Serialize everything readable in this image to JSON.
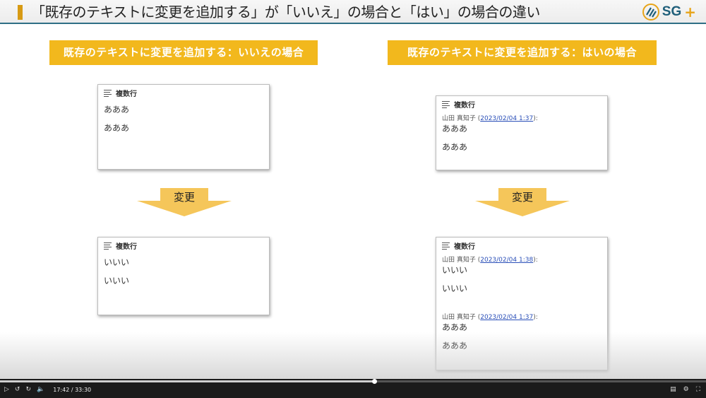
{
  "header": {
    "title": "「既存のテキストに変更を追加する」が「いいえ」の場合と「はい」の場合の違い",
    "logo_text": "SG",
    "logo_plus": "+"
  },
  "left": {
    "heading": "既存のテキストに変更を追加する：いいえの場合",
    "before": {
      "label": "複数行",
      "lines": [
        "あああ",
        "あああ"
      ]
    },
    "arrow_label": "変更",
    "after": {
      "label": "複数行",
      "lines": [
        "いいい",
        "いいい"
      ]
    }
  },
  "right": {
    "heading": "既存のテキストに変更を追加する：はいの場合",
    "before": {
      "label": "複数行",
      "entry": {
        "author": "山田 真知子",
        "timestamp": "2023/02/04 1:37",
        "lines": [
          "あああ",
          "あああ"
        ]
      }
    },
    "arrow_label": "変更",
    "after": {
      "label": "複数行",
      "entries": [
        {
          "author": "山田 真知子",
          "timestamp": "2023/02/04 1:38",
          "lines": [
            "いいい",
            "いいい"
          ]
        },
        {
          "author": "山田 真知子",
          "timestamp": "2023/02/04 1:37",
          "lines": [
            "あああ",
            "あああ"
          ]
        }
      ]
    }
  },
  "player": {
    "time": "17:42 / 33:30",
    "progress": 0.53,
    "controls": [
      "play-icon",
      "rewind-icon",
      "forward-icon",
      "volume-icon"
    ],
    "right_controls": [
      "captions-icon",
      "settings-icon",
      "fullscreen-icon"
    ]
  },
  "colors": {
    "accent": "#f2b81d",
    "arrow": "#f5c65a",
    "header_rule": "#2f6f86",
    "link": "#2a4fb8"
  }
}
